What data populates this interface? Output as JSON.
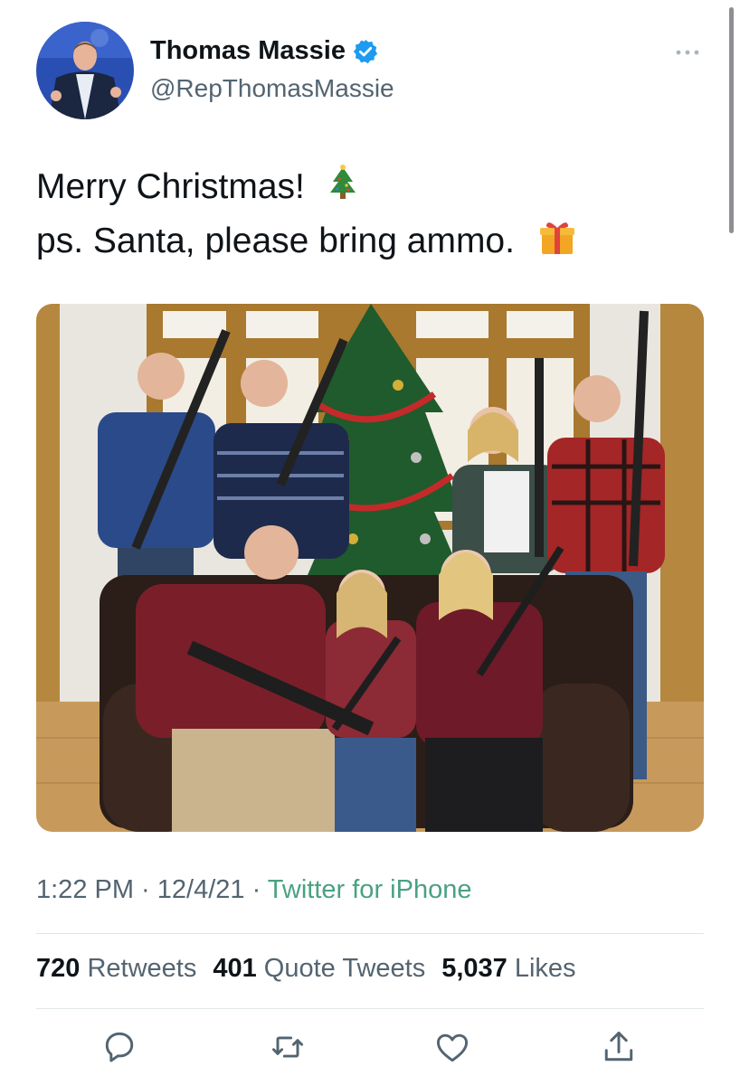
{
  "tweet": {
    "author_name": "Thomas Massie",
    "author_handle": "@RepThomasMassie",
    "verified": true,
    "text_line1": "Merry Christmas!",
    "text_line2": "ps. Santa, please bring ammo.",
    "emoji_line1": "christmas-tree-emoji",
    "emoji_line2": "wrapped-gift-emoji",
    "time": "1:22 PM",
    "separator": " · ",
    "date": "12/4/21",
    "source": "Twitter for iPhone"
  },
  "stats": {
    "retweets_count": "720",
    "retweets_label": "Retweets",
    "quotes_count": "401",
    "quotes_label": "Quote Tweets",
    "likes_count": "5,037",
    "likes_label": "Likes"
  },
  "actions": [
    "reply-icon",
    "retweet-icon",
    "like-icon",
    "share-icon"
  ],
  "colors": {
    "text": "#0f1419",
    "secondary": "#536471",
    "source_link": "#4aa181",
    "verified": "#1d9bf0",
    "divider": "#e1e6ea"
  }
}
